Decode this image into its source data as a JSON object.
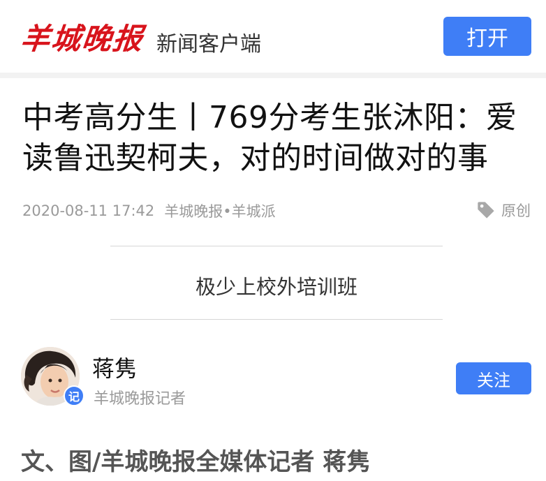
{
  "header": {
    "logo_text": "羊城晚报",
    "app_label": "新闻客户端",
    "open_button": "打开"
  },
  "article": {
    "title": "中考高分生丨769分考生张沐阳：爱读鲁迅契柯夫，对的时间做对的事",
    "datetime": "2020-08-11 17:42",
    "source": "羊城晚报•羊城派",
    "original_label": "原创",
    "subheading": "极少上校外培训班",
    "byline": "文、图/羊城晚报全媒体记者 蒋隽"
  },
  "author": {
    "name": "蒋隽",
    "role": "羊城晚报记者",
    "badge": "记",
    "follow_button": "关注"
  },
  "colors": {
    "brand_red": "#d8141c",
    "accent_blue": "#3f7ef6"
  },
  "icons": {
    "tag": "tag-icon",
    "avatar": "author-avatar"
  }
}
